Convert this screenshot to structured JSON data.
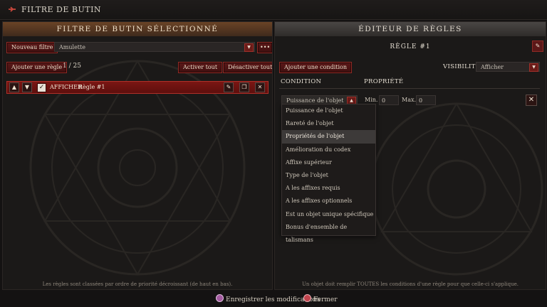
{
  "topbar": {
    "title": "FILTRE DE BUTIN"
  },
  "left_panel": {
    "header": "FILTRE DE BUTIN SÉLECTIONNÉ",
    "new_filter_label": "Nouveau filtre",
    "filter_select": {
      "value": "Amulette"
    },
    "more_label": "•••",
    "add_rule_label": "Ajouter une règle",
    "rule_count": "1 / 25",
    "enable_all_label": "Activer tout",
    "disable_all_label": "Désactiver tout",
    "rule": {
      "action": "AFFICHER",
      "name": "Règle #1",
      "checked": true
    },
    "footer": "Les règles sont classées par ordre de priorité décroissant (de haut en bas)."
  },
  "right_panel": {
    "header": "ÉDITEUR DE RÈGLES",
    "rule_title": "RÈGLE #1",
    "add_condition_label": "Ajouter une condition",
    "visibility_label": "VISIBILITÉ",
    "visibility_value": "Afficher",
    "condition_header": "CONDITION",
    "property_header": "PROPRIÉTÉ",
    "condition_value": "Puissance de l'objet",
    "min_label": "Min.",
    "min_value": "0",
    "max_label": "Max.",
    "max_value": "0",
    "footer": "Un objet doit remplir TOUTES les conditions d'une règle pour que celle-ci s'applique."
  },
  "condition_menu": {
    "items": [
      "Puissance de l'objet",
      "Rareté de l'objet",
      "Propriétés de l'objet",
      "Amélioration du codex",
      "Affixe supérieur",
      "Type de l'objet",
      "A les affixes requis",
      "A les affixes optionnels",
      "Est un objet unique spécifique",
      "Bonus d'ensemble de talismans"
    ],
    "highlighted_index": 2
  },
  "bottom": {
    "save_label": "Enregistrer les modifications",
    "close_label": "Fermer"
  },
  "colors": {
    "accent_red": "#8f2a25",
    "header_bronze": "#6a4326"
  }
}
